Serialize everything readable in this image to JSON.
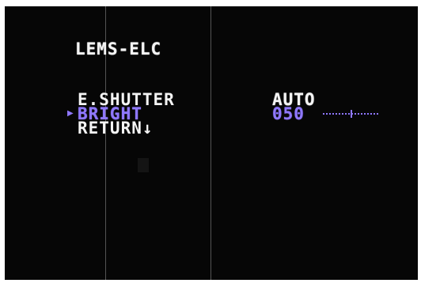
{
  "menu": {
    "title": "LEMS-ELC",
    "items": [
      {
        "label": "E.SHUTTER",
        "value": "AUTO"
      },
      {
        "label": "BRIGHT",
        "value": "050"
      },
      {
        "label": "RETURN↓"
      }
    ],
    "cursor_glyph": "▶",
    "bright_level": 0.5
  },
  "colors": {
    "background": "#060606",
    "text": "#f4f4f4",
    "highlight": "#8f78ff",
    "gridline": "#6f6f6f"
  }
}
